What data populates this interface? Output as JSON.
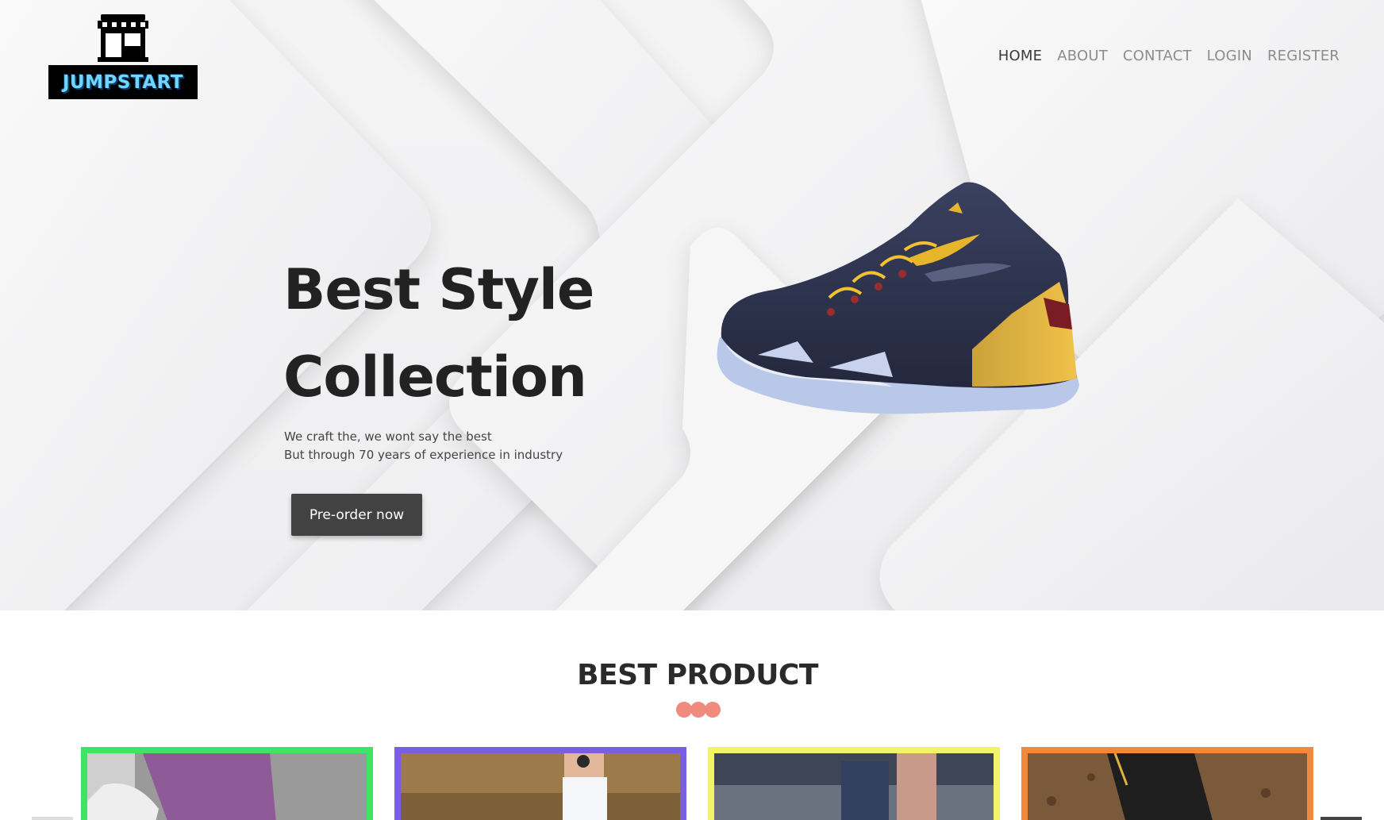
{
  "brand": {
    "name": "JUMPSTART"
  },
  "nav": {
    "items": [
      {
        "label": "HOME",
        "active": true
      },
      {
        "label": "ABOUT",
        "active": false
      },
      {
        "label": "CONTACT",
        "active": false
      },
      {
        "label": "LOGIN",
        "active": false
      },
      {
        "label": "REGISTER",
        "active": false
      }
    ]
  },
  "hero": {
    "title_line1": "Best Style",
    "title_line2": "Collection",
    "subtitle_line1": "We craft the, we wont say the best",
    "subtitle_line2": "But through 70 years of experience in industry",
    "cta_label": "Pre-order now",
    "image_icon": "basketball-shoe"
  },
  "best_product": {
    "title": "BEST PRODUCT",
    "accent_color": "#f08a7e",
    "cards": [
      {
        "border_color": "#3ee468",
        "image_icon": "legs-leggings-photo"
      },
      {
        "border_color": "#7b5ee6",
        "image_icon": "sock-tattoo-photo"
      },
      {
        "border_color": "#f3f36a",
        "image_icon": "running-blur-photo"
      },
      {
        "border_color": "#f08a3a",
        "image_icon": "shoe-on-dirt-photo"
      }
    ]
  }
}
